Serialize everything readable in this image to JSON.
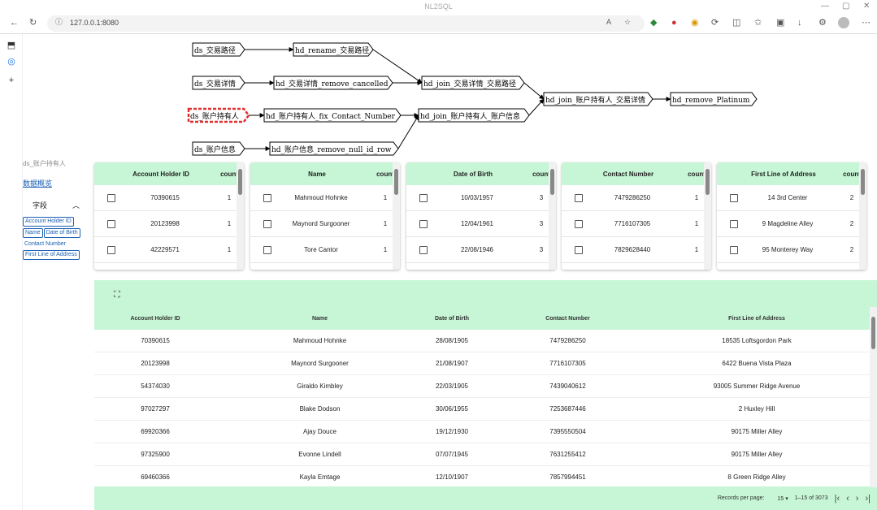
{
  "browser": {
    "tab_title": "NL2SQL",
    "url": "127.0.0.1:8080",
    "win_controls": [
      "—",
      "▢",
      "✕"
    ]
  },
  "graph": {
    "nodes": [
      {
        "id": "n1",
        "label": "ds_交易路径",
        "highlighted": false
      },
      {
        "id": "n2",
        "label": "hd_rename_交易路径",
        "highlighted": false
      },
      {
        "id": "n3",
        "label": "ds_交易详情",
        "highlighted": false
      },
      {
        "id": "n4",
        "label": "hd_交易详情_remove_cancelled",
        "highlighted": false
      },
      {
        "id": "n5",
        "label": "hd_join_交易详情_交易路径",
        "highlighted": false
      },
      {
        "id": "n6",
        "label": "ds_账户持有人",
        "highlighted": true
      },
      {
        "id": "n7",
        "label": "hd_账户持有人_fix_Contact_Number",
        "highlighted": false
      },
      {
        "id": "n8",
        "label": "hd_join_账户持有人_账户信息",
        "highlighted": false
      },
      {
        "id": "n9",
        "label": "hd_join_账户持有人_交易详情",
        "highlighted": false
      },
      {
        "id": "n10",
        "label": "hd_remove_Platinum",
        "highlighted": false
      },
      {
        "id": "n11",
        "label": "ds_账户信息",
        "highlighted": false
      },
      {
        "id": "n12",
        "label": "hd_账户信息_remove_null_id_row",
        "highlighted": false
      }
    ],
    "edges": [
      [
        "n1",
        "n2"
      ],
      [
        "n2",
        "n5"
      ],
      [
        "n3",
        "n4"
      ],
      [
        "n4",
        "n5"
      ],
      [
        "n5",
        "n9"
      ],
      [
        "n6",
        "n7"
      ],
      [
        "n7",
        "n8"
      ],
      [
        "n8",
        "n9"
      ],
      [
        "n9",
        "n10"
      ],
      [
        "n11",
        "n12"
      ],
      [
        "n12",
        "n8"
      ]
    ]
  },
  "left_panel": {
    "title": "ds_账户持有人",
    "link": "数据概览",
    "section": "字段",
    "chevron": "︿",
    "chips": [
      "Account Holder ID",
      "Name",
      "Date of Birth",
      "Contact Number",
      "First Line of Address"
    ]
  },
  "cards": [
    {
      "header": "Account Holder ID",
      "count_label": "count",
      "rows": [
        {
          "value": "70390615",
          "count": "1"
        },
        {
          "value": "20123998",
          "count": "1"
        },
        {
          "value": "42229571",
          "count": "1"
        }
      ]
    },
    {
      "header": "Name",
      "count_label": "count",
      "rows": [
        {
          "value": "Mahmoud Hohnke",
          "count": "1"
        },
        {
          "value": "Maynord Surgooner",
          "count": "1"
        },
        {
          "value": "Tore Cantor",
          "count": "1"
        }
      ]
    },
    {
      "header": "Date of Birth",
      "count_label": "count",
      "rows": [
        {
          "value": "10/03/1957",
          "count": "3"
        },
        {
          "value": "12/04/1961",
          "count": "3"
        },
        {
          "value": "22/08/1946",
          "count": "3"
        }
      ]
    },
    {
      "header": "Contact Number",
      "count_label": "count",
      "rows": [
        {
          "value": "7479286250",
          "count": "1"
        },
        {
          "value": "7716107305",
          "count": "1"
        },
        {
          "value": "7829628440",
          "count": "1"
        }
      ]
    },
    {
      "header": "First Line of Address",
      "count_label": "count",
      "rows": [
        {
          "value": "14 3rd Center",
          "count": "2"
        },
        {
          "value": "9 Magdeline Alley",
          "count": "2"
        },
        {
          "value": "95 Monterey Way",
          "count": "2"
        }
      ]
    }
  ],
  "table": {
    "expand_icon": "⛶",
    "columns": [
      "Account Holder ID",
      "Name",
      "Date of Birth",
      "Contact Number",
      "First Line of Address"
    ],
    "rows": [
      [
        "70390615",
        "Mahmoud Hohnke",
        "28/08/1905",
        "7479286250",
        "18535 Loftsgordon Park"
      ],
      [
        "20123998",
        "Maynord Surgooner",
        "21/08/1907",
        "7716107305",
        "6422 Buena Vista Plaza"
      ],
      [
        "54374030",
        "Giraldo Kimbley",
        "22/03/1905",
        "7439040612",
        "93005 Summer Ridge Avenue"
      ],
      [
        "97027297",
        "Blake Dodson",
        "30/06/1955",
        "7253687446",
        "2 Huxley Hill"
      ],
      [
        "69920366",
        "Ajay Douce",
        "19/12/1930",
        "7395550504",
        "90175 Miller Alley"
      ],
      [
        "97325900",
        "Evonne Lindell",
        "07/07/1945",
        "7631255412",
        "90175 Miller Alley"
      ],
      [
        "69460366",
        "Kayla Emtage",
        "12/10/1907",
        "7857994451",
        "8 Green Ridge Alley"
      ]
    ],
    "pager": {
      "rows_label": "Records per page:",
      "rows_value": "15",
      "range": "1–15 of 3073"
    }
  }
}
